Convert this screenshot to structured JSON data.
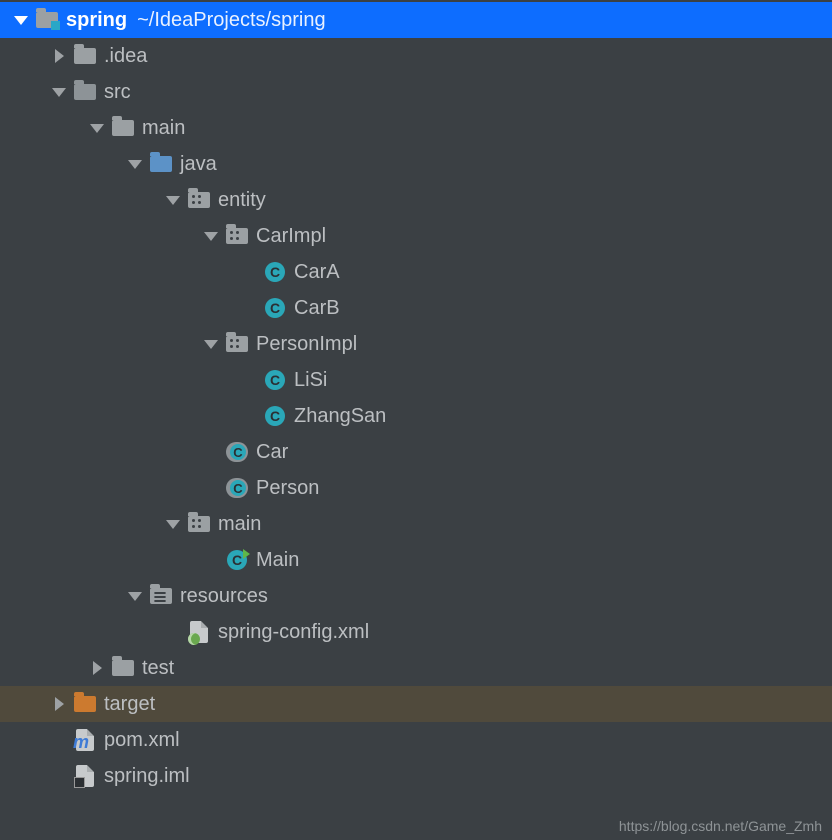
{
  "project": {
    "name": "spring",
    "path": "~/IdeaProjects/spring"
  },
  "tree": {
    "idea": ".idea",
    "src": "src",
    "main": "main",
    "java": "java",
    "entity": "entity",
    "carImpl": "CarImpl",
    "carA": "CarA",
    "carB": "CarB",
    "personImpl": "PersonImpl",
    "liSi": "LiSi",
    "zhangSan": "ZhangSan",
    "carIface": "Car",
    "personIface": "Person",
    "mainPkg": "main",
    "mainClass": "Main",
    "resources": "resources",
    "springConfig": "spring-config.xml",
    "test": "test",
    "target": "target",
    "pom": "pom.xml",
    "iml": "spring.iml"
  },
  "watermark": "https://blog.csdn.net/Game_Zmh"
}
